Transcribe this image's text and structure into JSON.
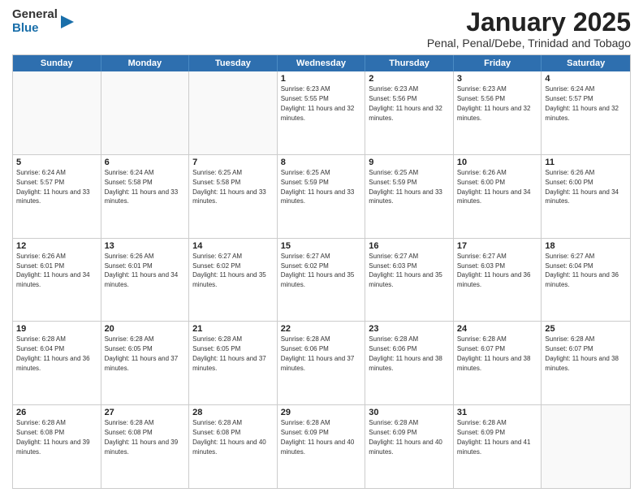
{
  "header": {
    "logo_general": "General",
    "logo_blue": "Blue",
    "title": "January 2025",
    "subtitle": "Penal, Penal/Debe, Trinidad and Tobago"
  },
  "calendar": {
    "days_of_week": [
      "Sunday",
      "Monday",
      "Tuesday",
      "Wednesday",
      "Thursday",
      "Friday",
      "Saturday"
    ],
    "weeks": [
      [
        {
          "day": "",
          "empty": true
        },
        {
          "day": "",
          "empty": true
        },
        {
          "day": "",
          "empty": true
        },
        {
          "day": "1",
          "sunrise": "6:23 AM",
          "sunset": "5:55 PM",
          "daylight": "11 hours and 32 minutes."
        },
        {
          "day": "2",
          "sunrise": "6:23 AM",
          "sunset": "5:56 PM",
          "daylight": "11 hours and 32 minutes."
        },
        {
          "day": "3",
          "sunrise": "6:23 AM",
          "sunset": "5:56 PM",
          "daylight": "11 hours and 32 minutes."
        },
        {
          "day": "4",
          "sunrise": "6:24 AM",
          "sunset": "5:57 PM",
          "daylight": "11 hours and 32 minutes."
        }
      ],
      [
        {
          "day": "5",
          "sunrise": "6:24 AM",
          "sunset": "5:57 PM",
          "daylight": "11 hours and 33 minutes."
        },
        {
          "day": "6",
          "sunrise": "6:24 AM",
          "sunset": "5:58 PM",
          "daylight": "11 hours and 33 minutes."
        },
        {
          "day": "7",
          "sunrise": "6:25 AM",
          "sunset": "5:58 PM",
          "daylight": "11 hours and 33 minutes."
        },
        {
          "day": "8",
          "sunrise": "6:25 AM",
          "sunset": "5:59 PM",
          "daylight": "11 hours and 33 minutes."
        },
        {
          "day": "9",
          "sunrise": "6:25 AM",
          "sunset": "5:59 PM",
          "daylight": "11 hours and 33 minutes."
        },
        {
          "day": "10",
          "sunrise": "6:26 AM",
          "sunset": "6:00 PM",
          "daylight": "11 hours and 34 minutes."
        },
        {
          "day": "11",
          "sunrise": "6:26 AM",
          "sunset": "6:00 PM",
          "daylight": "11 hours and 34 minutes."
        }
      ],
      [
        {
          "day": "12",
          "sunrise": "6:26 AM",
          "sunset": "6:01 PM",
          "daylight": "11 hours and 34 minutes."
        },
        {
          "day": "13",
          "sunrise": "6:26 AM",
          "sunset": "6:01 PM",
          "daylight": "11 hours and 34 minutes."
        },
        {
          "day": "14",
          "sunrise": "6:27 AM",
          "sunset": "6:02 PM",
          "daylight": "11 hours and 35 minutes."
        },
        {
          "day": "15",
          "sunrise": "6:27 AM",
          "sunset": "6:02 PM",
          "daylight": "11 hours and 35 minutes."
        },
        {
          "day": "16",
          "sunrise": "6:27 AM",
          "sunset": "6:03 PM",
          "daylight": "11 hours and 35 minutes."
        },
        {
          "day": "17",
          "sunrise": "6:27 AM",
          "sunset": "6:03 PM",
          "daylight": "11 hours and 36 minutes."
        },
        {
          "day": "18",
          "sunrise": "6:27 AM",
          "sunset": "6:04 PM",
          "daylight": "11 hours and 36 minutes."
        }
      ],
      [
        {
          "day": "19",
          "sunrise": "6:28 AM",
          "sunset": "6:04 PM",
          "daylight": "11 hours and 36 minutes."
        },
        {
          "day": "20",
          "sunrise": "6:28 AM",
          "sunset": "6:05 PM",
          "daylight": "11 hours and 37 minutes."
        },
        {
          "day": "21",
          "sunrise": "6:28 AM",
          "sunset": "6:05 PM",
          "daylight": "11 hours and 37 minutes."
        },
        {
          "day": "22",
          "sunrise": "6:28 AM",
          "sunset": "6:06 PM",
          "daylight": "11 hours and 37 minutes."
        },
        {
          "day": "23",
          "sunrise": "6:28 AM",
          "sunset": "6:06 PM",
          "daylight": "11 hours and 38 minutes."
        },
        {
          "day": "24",
          "sunrise": "6:28 AM",
          "sunset": "6:07 PM",
          "daylight": "11 hours and 38 minutes."
        },
        {
          "day": "25",
          "sunrise": "6:28 AM",
          "sunset": "6:07 PM",
          "daylight": "11 hours and 38 minutes."
        }
      ],
      [
        {
          "day": "26",
          "sunrise": "6:28 AM",
          "sunset": "6:08 PM",
          "daylight": "11 hours and 39 minutes."
        },
        {
          "day": "27",
          "sunrise": "6:28 AM",
          "sunset": "6:08 PM",
          "daylight": "11 hours and 39 minutes."
        },
        {
          "day": "28",
          "sunrise": "6:28 AM",
          "sunset": "6:08 PM",
          "daylight": "11 hours and 40 minutes."
        },
        {
          "day": "29",
          "sunrise": "6:28 AM",
          "sunset": "6:09 PM",
          "daylight": "11 hours and 40 minutes."
        },
        {
          "day": "30",
          "sunrise": "6:28 AM",
          "sunset": "6:09 PM",
          "daylight": "11 hours and 40 minutes."
        },
        {
          "day": "31",
          "sunrise": "6:28 AM",
          "sunset": "6:09 PM",
          "daylight": "11 hours and 41 minutes."
        },
        {
          "day": "",
          "empty": true
        }
      ]
    ]
  }
}
